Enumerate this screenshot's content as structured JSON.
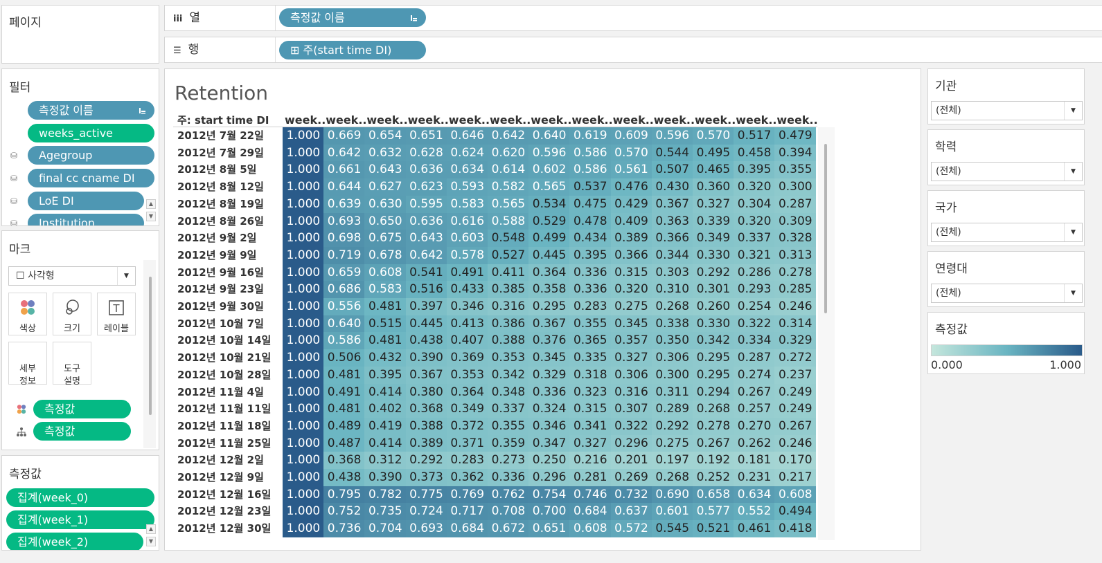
{
  "pages_card": {
    "title": "페이지"
  },
  "shelves": {
    "columns": {
      "icon": "iii",
      "label": "열",
      "pill": "측정값 이름"
    },
    "rows": {
      "icon": "☰",
      "label": "행",
      "pill": "⊞ 주(start time DI)"
    }
  },
  "filters_card": {
    "title": "필터",
    "items": [
      {
        "label": "측정값 이름",
        "color": "blue"
      },
      {
        "label": "weeks_active",
        "color": "green"
      },
      {
        "label": "Agegroup",
        "color": "blue"
      },
      {
        "label": "final cc cname DI",
        "color": "blue"
      },
      {
        "label": "LoE DI",
        "color": "blue"
      },
      {
        "label": "Institution",
        "color": "blue"
      }
    ]
  },
  "marks_card": {
    "title": "마크",
    "mark_type": "☐ 사각형",
    "buttons": [
      {
        "label": "색상",
        "icon": "color-icon"
      },
      {
        "label": "크기",
        "icon": "size-icon"
      },
      {
        "label": "레이블",
        "icon": "label-icon"
      },
      {
        "label": "세부\n정보",
        "icon": "detail-icon"
      },
      {
        "label": "도구\n설명",
        "icon": "tooltip-icon"
      }
    ],
    "assigned": [
      {
        "label": "측정값",
        "icon": "color-icon"
      },
      {
        "label": "측정값",
        "icon": "tooltip-icon"
      }
    ]
  },
  "measures_card": {
    "title": "측정값",
    "items": [
      "집계(week_0)",
      "집계(week_1)",
      "집계(week_2)"
    ]
  },
  "view": {
    "title": "Retention",
    "row_header": "주: start time DI"
  },
  "right_filters": [
    {
      "title": "기관",
      "value": "(전체)"
    },
    {
      "title": "학력",
      "value": "(전체)"
    },
    {
      "title": "국가",
      "value": "(전체)"
    },
    {
      "title": "연령대",
      "value": "(전체)"
    }
  ],
  "legend": {
    "title": "측정값",
    "min_label": "0.000",
    "max_label": "1.000",
    "color_low": "#c4e6dc",
    "color_high": "#2a5b8a"
  },
  "chart_data": {
    "type": "heatmap",
    "column_headers": [
      "week..",
      "week..",
      "week..",
      "week..",
      "week..",
      "week..",
      "week..",
      "week..",
      "week..",
      "week..",
      "week..",
      "week..",
      "week.."
    ],
    "rows": [
      "2012년 7월 22일",
      "2012년 7월 29일",
      "2012년 8월 5일",
      "2012년 8월 12일",
      "2012년 8월 19일",
      "2012년 8월 26일",
      "2012년 9월 2일",
      "2012년 9월 9일",
      "2012년 9월 16일",
      "2012년 9월 23일",
      "2012년 9월 30일",
      "2012년 10월 7일",
      "2012년 10월 14일",
      "2012년 10월 21일",
      "2012년 10월 28일",
      "2012년 11월 4일",
      "2012년 11월 11일",
      "2012년 11월 18일",
      "2012년 11월 25일",
      "2012년 12월 2일",
      "2012년 12월 9일",
      "2012년 12월 16일",
      "2012년 12월 23일",
      "2012년 12월 30일"
    ],
    "values": [
      [
        1.0,
        0.669,
        0.654,
        0.651,
        0.646,
        0.642,
        0.64,
        0.619,
        0.609,
        0.596,
        0.57,
        0.517,
        0.479
      ],
      [
        1.0,
        0.642,
        0.632,
        0.628,
        0.624,
        0.62,
        0.596,
        0.586,
        0.57,
        0.544,
        0.495,
        0.458,
        0.394
      ],
      [
        1.0,
        0.661,
        0.643,
        0.636,
        0.634,
        0.614,
        0.602,
        0.586,
        0.561,
        0.507,
        0.465,
        0.395,
        0.355
      ],
      [
        1.0,
        0.644,
        0.627,
        0.623,
        0.593,
        0.582,
        0.565,
        0.537,
        0.476,
        0.43,
        0.36,
        0.32,
        0.3
      ],
      [
        1.0,
        0.639,
        0.63,
        0.595,
        0.583,
        0.565,
        0.534,
        0.475,
        0.429,
        0.367,
        0.327,
        0.304,
        0.287
      ],
      [
        1.0,
        0.693,
        0.65,
        0.636,
        0.616,
        0.588,
        0.529,
        0.478,
        0.409,
        0.363,
        0.339,
        0.32,
        0.309
      ],
      [
        1.0,
        0.698,
        0.675,
        0.643,
        0.603,
        0.548,
        0.499,
        0.434,
        0.389,
        0.366,
        0.349,
        0.337,
        0.328
      ],
      [
        1.0,
        0.719,
        0.678,
        0.642,
        0.578,
        0.527,
        0.445,
        0.395,
        0.366,
        0.344,
        0.33,
        0.321,
        0.313
      ],
      [
        1.0,
        0.659,
        0.608,
        0.541,
        0.491,
        0.411,
        0.364,
        0.336,
        0.315,
        0.303,
        0.292,
        0.286,
        0.278
      ],
      [
        1.0,
        0.686,
        0.583,
        0.516,
        0.433,
        0.385,
        0.358,
        0.336,
        0.32,
        0.31,
        0.301,
        0.293,
        0.285
      ],
      [
        1.0,
        0.556,
        0.481,
        0.397,
        0.346,
        0.316,
        0.295,
        0.283,
        0.275,
        0.268,
        0.26,
        0.254,
        0.246
      ],
      [
        1.0,
        0.64,
        0.515,
        0.445,
        0.413,
        0.386,
        0.367,
        0.355,
        0.345,
        0.338,
        0.33,
        0.322,
        0.314
      ],
      [
        1.0,
        0.586,
        0.481,
        0.438,
        0.407,
        0.388,
        0.376,
        0.365,
        0.357,
        0.35,
        0.342,
        0.334,
        0.329
      ],
      [
        1.0,
        0.506,
        0.432,
        0.39,
        0.369,
        0.353,
        0.345,
        0.335,
        0.327,
        0.306,
        0.295,
        0.287,
        0.272
      ],
      [
        1.0,
        0.481,
        0.395,
        0.367,
        0.353,
        0.342,
        0.329,
        0.318,
        0.306,
        0.3,
        0.295,
        0.274,
        0.237
      ],
      [
        1.0,
        0.491,
        0.414,
        0.38,
        0.364,
        0.348,
        0.336,
        0.323,
        0.316,
        0.311,
        0.294,
        0.267,
        0.249
      ],
      [
        1.0,
        0.481,
        0.402,
        0.368,
        0.349,
        0.337,
        0.324,
        0.315,
        0.307,
        0.289,
        0.268,
        0.257,
        0.249
      ],
      [
        1.0,
        0.489,
        0.419,
        0.388,
        0.372,
        0.355,
        0.346,
        0.341,
        0.322,
        0.292,
        0.278,
        0.27,
        0.267
      ],
      [
        1.0,
        0.487,
        0.414,
        0.389,
        0.371,
        0.359,
        0.347,
        0.327,
        0.296,
        0.275,
        0.267,
        0.262,
        0.246
      ],
      [
        1.0,
        0.368,
        0.312,
        0.292,
        0.283,
        0.273,
        0.25,
        0.216,
        0.201,
        0.197,
        0.192,
        0.181,
        0.17
      ],
      [
        1.0,
        0.438,
        0.39,
        0.373,
        0.362,
        0.336,
        0.296,
        0.281,
        0.269,
        0.268,
        0.252,
        0.231,
        0.217
      ],
      [
        1.0,
        0.795,
        0.782,
        0.775,
        0.769,
        0.762,
        0.754,
        0.746,
        0.732,
        0.69,
        0.658,
        0.634,
        0.608
      ],
      [
        1.0,
        0.752,
        0.735,
        0.724,
        0.717,
        0.708,
        0.7,
        0.684,
        0.637,
        0.601,
        0.577,
        0.552,
        0.494
      ],
      [
        1.0,
        0.736,
        0.704,
        0.693,
        0.684,
        0.672,
        0.651,
        0.608,
        0.572,
        0.545,
        0.521,
        0.461,
        0.418
      ]
    ],
    "color_range": [
      0,
      1
    ]
  }
}
